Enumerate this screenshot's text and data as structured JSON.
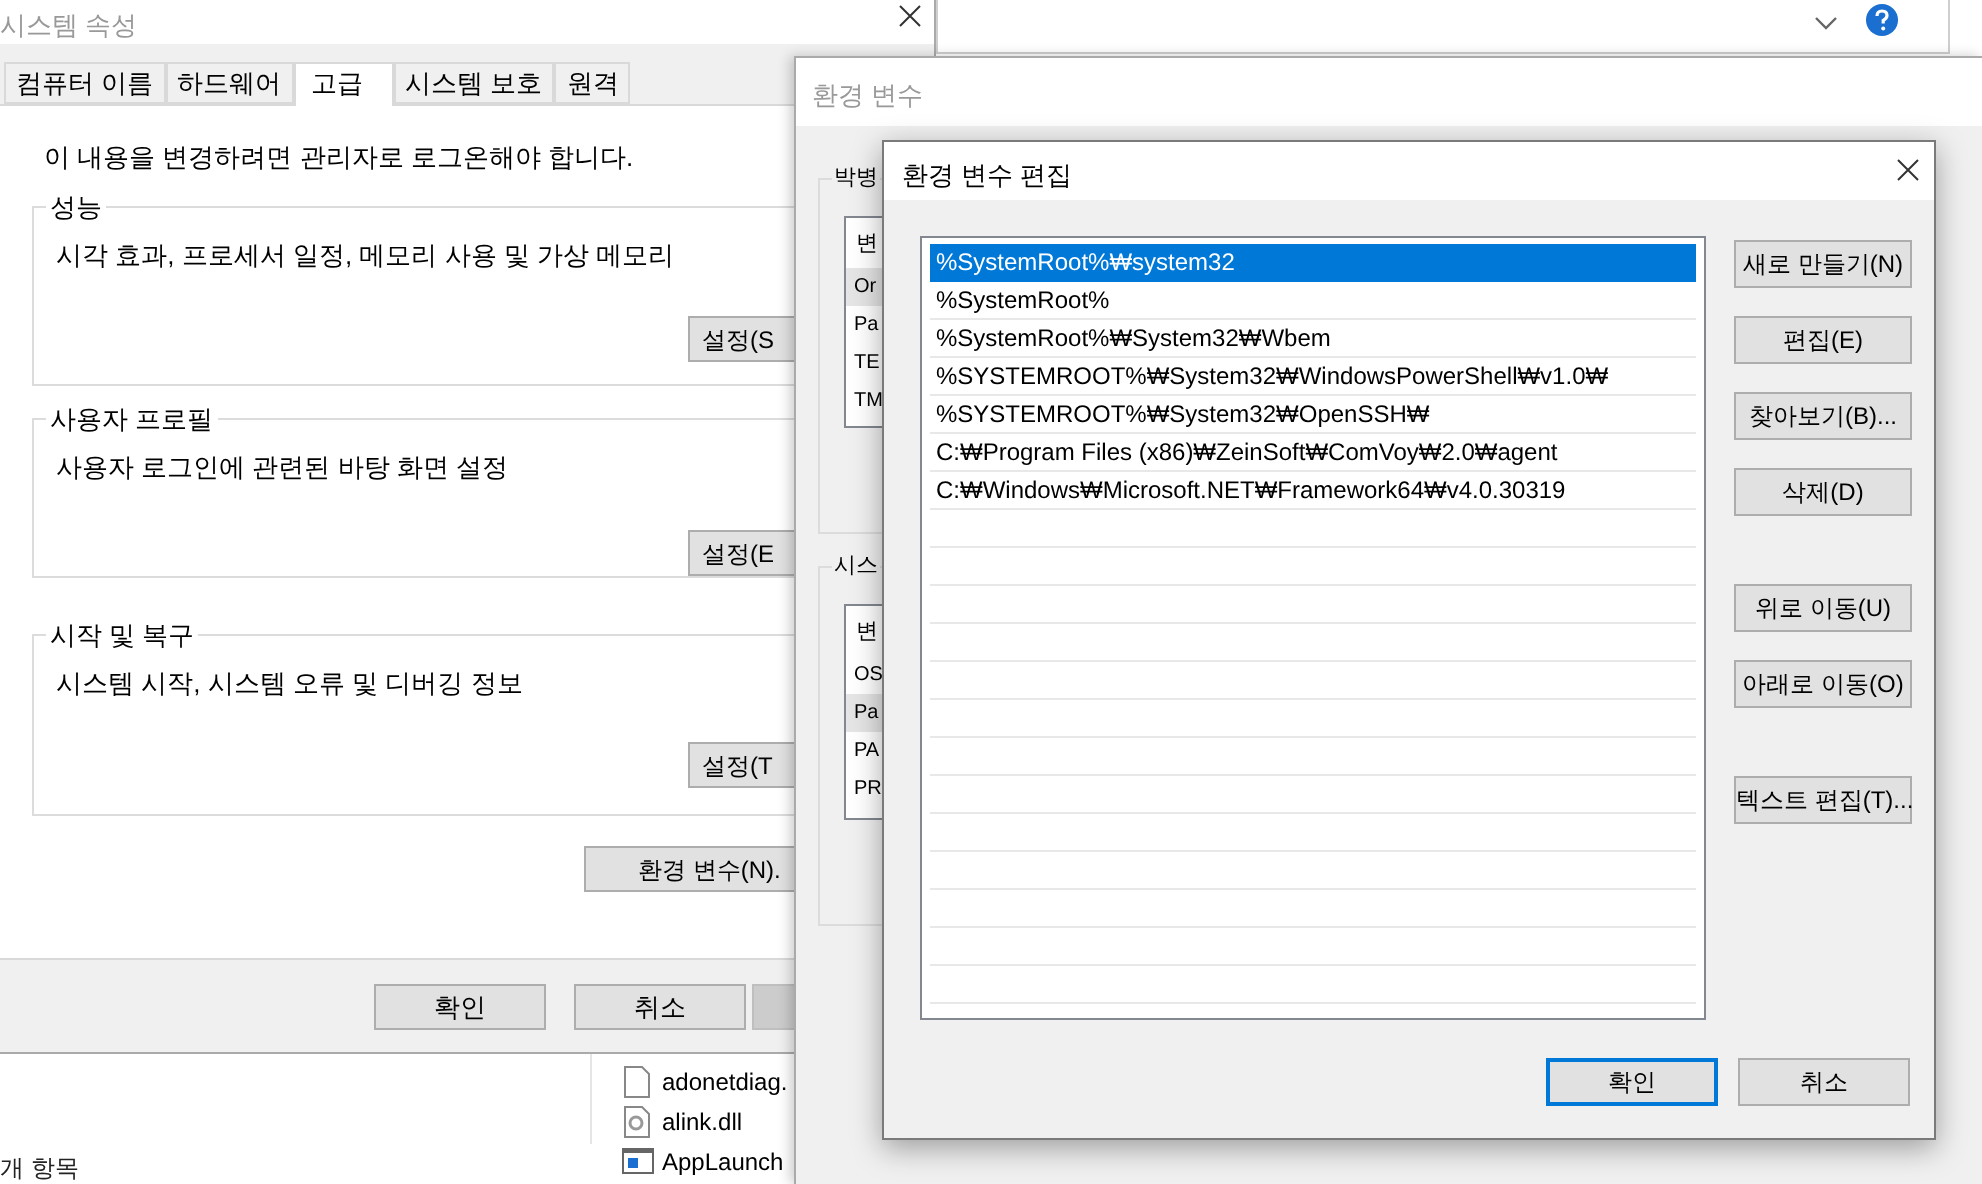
{
  "explorer": {
    "files": [
      {
        "name": "adonetdiag.",
        "kind": "blank"
      },
      {
        "name": "alink.dll",
        "kind": "dll"
      },
      {
        "name": "AppLaunch",
        "kind": "app"
      }
    ],
    "status": "개 항목"
  },
  "system_properties": {
    "title": "시스템 속성",
    "tabs": [
      {
        "label": "컴퓨터 이름",
        "selected": false
      },
      {
        "label": "하드웨어",
        "selected": false
      },
      {
        "label": "고급",
        "selected": true
      },
      {
        "label": "시스템 보호",
        "selected": false
      },
      {
        "label": "원격",
        "selected": false
      }
    ],
    "notice": "이 내용을 변경하려면 관리자로 로그온해야 합니다.",
    "groups": [
      {
        "title": "성능",
        "description": "시각 효과, 프로세서 일정, 메모리 사용 및 가상 메모리",
        "button": "설정(S"
      },
      {
        "title": "사용자 프로필",
        "description": "사용자 로그인에 관련된 바탕 화면 설정",
        "button": "설정(E"
      },
      {
        "title": "시작 및 복구",
        "description": "시스템 시작, 시스템 오류 및 디버깅 정보",
        "button": "설정(T"
      }
    ],
    "env_button": "환경 변수(N).",
    "buttons": [
      "확인",
      "취소"
    ]
  },
  "environment_variables": {
    "title": "환경 변수",
    "sections": [
      {
        "title": "박병",
        "header": "변",
        "rows": [
          {
            "text": "Or",
            "selected": true
          },
          {
            "text": "Pa",
            "selected": false
          },
          {
            "text": "TE",
            "selected": false
          },
          {
            "text": "TM",
            "selected": false
          }
        ]
      },
      {
        "title": "시스",
        "header": "변",
        "rows": [
          {
            "text": "OS",
            "selected": false
          },
          {
            "text": "Pa",
            "selected": true
          },
          {
            "text": "PA",
            "selected": false
          },
          {
            "text": "PR",
            "selected": false
          }
        ]
      }
    ]
  },
  "edit_dialog": {
    "title": "환경 변수 편집",
    "entries": [
      {
        "text": "%SystemRoot%₩system32",
        "selected": true
      },
      {
        "text": "%SystemRoot%",
        "selected": false
      },
      {
        "text": "%SystemRoot%₩System32₩Wbem",
        "selected": false
      },
      {
        "text": "%SYSTEMROOT%₩System32₩WindowsPowerShell₩v1.0₩",
        "selected": false
      },
      {
        "text": "%SYSTEMROOT%₩System32₩OpenSSH₩",
        "selected": false
      },
      {
        "text": "C:₩Program Files (x86)₩ZeinSoft₩ComVoy₩2.0₩agent",
        "selected": false
      },
      {
        "text": "C:₩Windows₩Microsoft.NET₩Framework64₩v4.0.30319",
        "selected": false
      }
    ],
    "button_groups": [
      [
        "새로 만들기(N)",
        "편집(E)",
        "찾아보기(B)...",
        "삭제(D)"
      ],
      [
        "위로 이동(U)",
        "아래로 이동(O)"
      ],
      [
        "텍스트 편집(T)..."
      ]
    ],
    "buttons": [
      {
        "label": "확인",
        "default": true
      },
      {
        "label": "취소",
        "default": false
      }
    ]
  }
}
